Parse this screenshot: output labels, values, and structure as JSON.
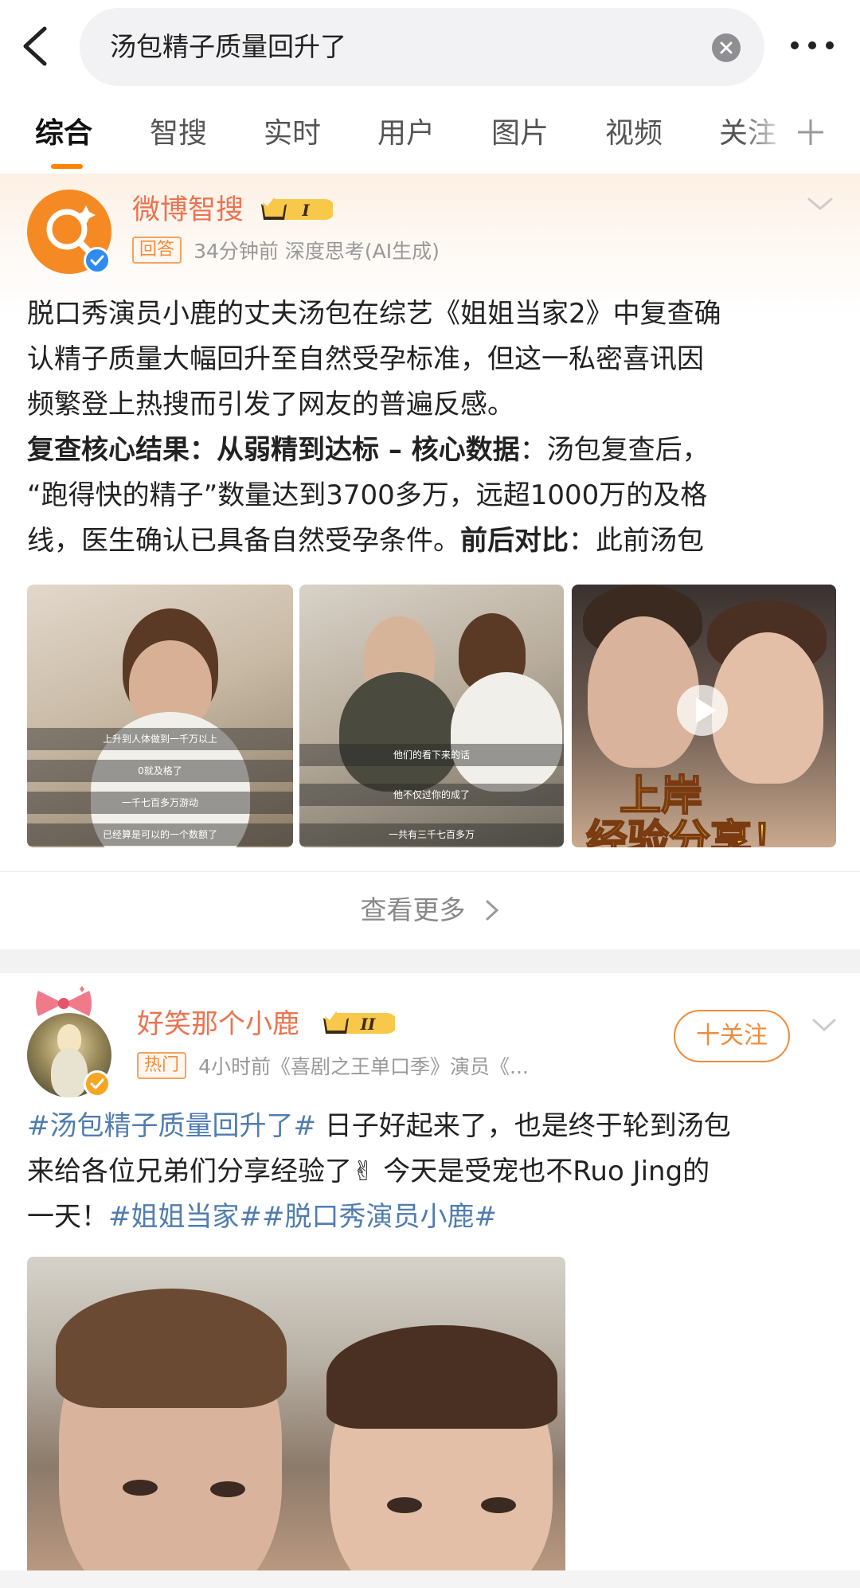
{
  "search": {
    "query": "汤包精子质量回升了"
  },
  "tabs": [
    {
      "label": "综合",
      "active": true
    },
    {
      "label": "智搜",
      "active": false
    },
    {
      "label": "实时",
      "active": false
    },
    {
      "label": "用户",
      "active": false
    },
    {
      "label": "图片",
      "active": false
    },
    {
      "label": "视频",
      "active": false
    },
    {
      "label": "关注",
      "active": false
    }
  ],
  "card1": {
    "author": "微博智搜",
    "level": "I",
    "tag": "回答",
    "meta": "34分钟前  深度思考(AI生成)",
    "lines": [
      "脱口秀演员小鹿的丈夫汤包在综艺《姐姐当家2》中复查确",
      "认精子质量大幅回升至自然受孕标准，但这一私密喜讯因",
      "频繁登上热搜而引发了网友的普遍反感。"
    ],
    "line4_bold": "复查核心结果：从弱精到达标 – 核心数据",
    "line4_rest": "：汤包复查后，",
    "line5": "“跑得快的精子”数量达到3700多万，远超1000万的及格",
    "line6_rest": "线，医生确认已具备自然受孕条件。",
    "line6_bold": "前后对比",
    "line6_tail": "：此前汤包",
    "images": [
      {
        "subtitles": [
          "上升到人体做到一千万以上",
          "0就及格了",
          "一千七百多万游动",
          "已经算是可以的一个数额了"
        ]
      },
      {
        "subtitles": [
          "他们的看下来的话",
          "他不仅过你的成了",
          "一共有三千七百多万"
        ]
      },
      {
        "overlay_line1": "上岸",
        "overlay_line2": "经验分享！"
      }
    ],
    "view_more": "查看更多"
  },
  "card2": {
    "author": "好笑那个小鹿",
    "level": "II",
    "tag": "热门",
    "meta": "4小时前《喜剧之王单口季》演员《...",
    "follow_label": "十关注",
    "hashtag1": "#汤包精子质量回升了#",
    "line1_rest": " 日子好起来了，也是终于轮到汤包",
    "line2": "来给各位兄弟们分享经验了✌ 今天是受宠也不Ruo Jing的",
    "line3_start": "一天！",
    "hashtag2": "#姐姐当家#",
    "hashtag3": "#脱口秀演员小鹿#"
  },
  "colors": {
    "accent": "#ff8200",
    "name": "#eb7350",
    "hashtag": "#507daf",
    "verify_blue": "#2f8bf0",
    "verify_gold": "#f6a623"
  },
  "icons": [
    "back-arrow-icon",
    "clear-icon",
    "more-dots-icon",
    "plus-icon",
    "chevron-down-icon",
    "crown-badge-icon",
    "chevron-right-icon",
    "play-icon",
    "bow-icon"
  ]
}
